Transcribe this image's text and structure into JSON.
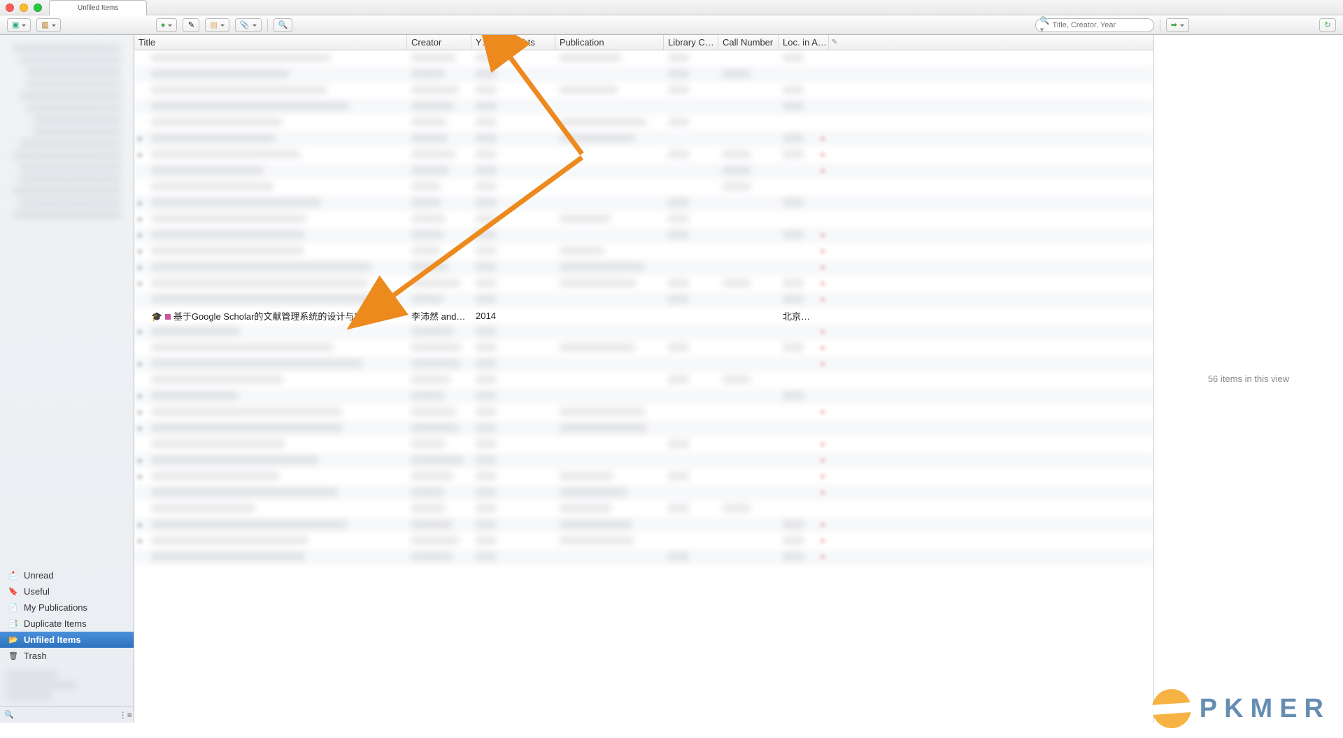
{
  "tab_title": "Unfiled Items",
  "toolbar": {
    "search_placeholder": "Title, Creator, Year"
  },
  "sidebar": {
    "items": [
      {
        "icon": "📩",
        "label": "Unread"
      },
      {
        "icon": "🔖",
        "label": "Useful"
      },
      {
        "icon": "📄",
        "label": "My Publications"
      },
      {
        "icon": "📑",
        "label": "Duplicate Items"
      },
      {
        "icon": "📂",
        "label": "Unfiled Items"
      },
      {
        "icon": "🗑",
        "label": "Trash"
      }
    ],
    "selected_index": 4
  },
  "columns": {
    "title": "Title",
    "creator": "Creator",
    "year": "Y…",
    "rights": "Rights",
    "publication": "Publication",
    "library_catalog": "Library C…",
    "call_number": "Call Number",
    "loc_in_archive": "Loc. in A…"
  },
  "focused_row": {
    "title": "基于Google Scholar的文献管理系统的设计与实现",
    "creator": "李沛然 and …",
    "year": "2014",
    "rights": "",
    "publication": "",
    "library_catalog": "",
    "call_number": "",
    "loc": "北京万方…"
  },
  "details": {
    "summary": "56 items in this view"
  },
  "watermark": "PKMER"
}
